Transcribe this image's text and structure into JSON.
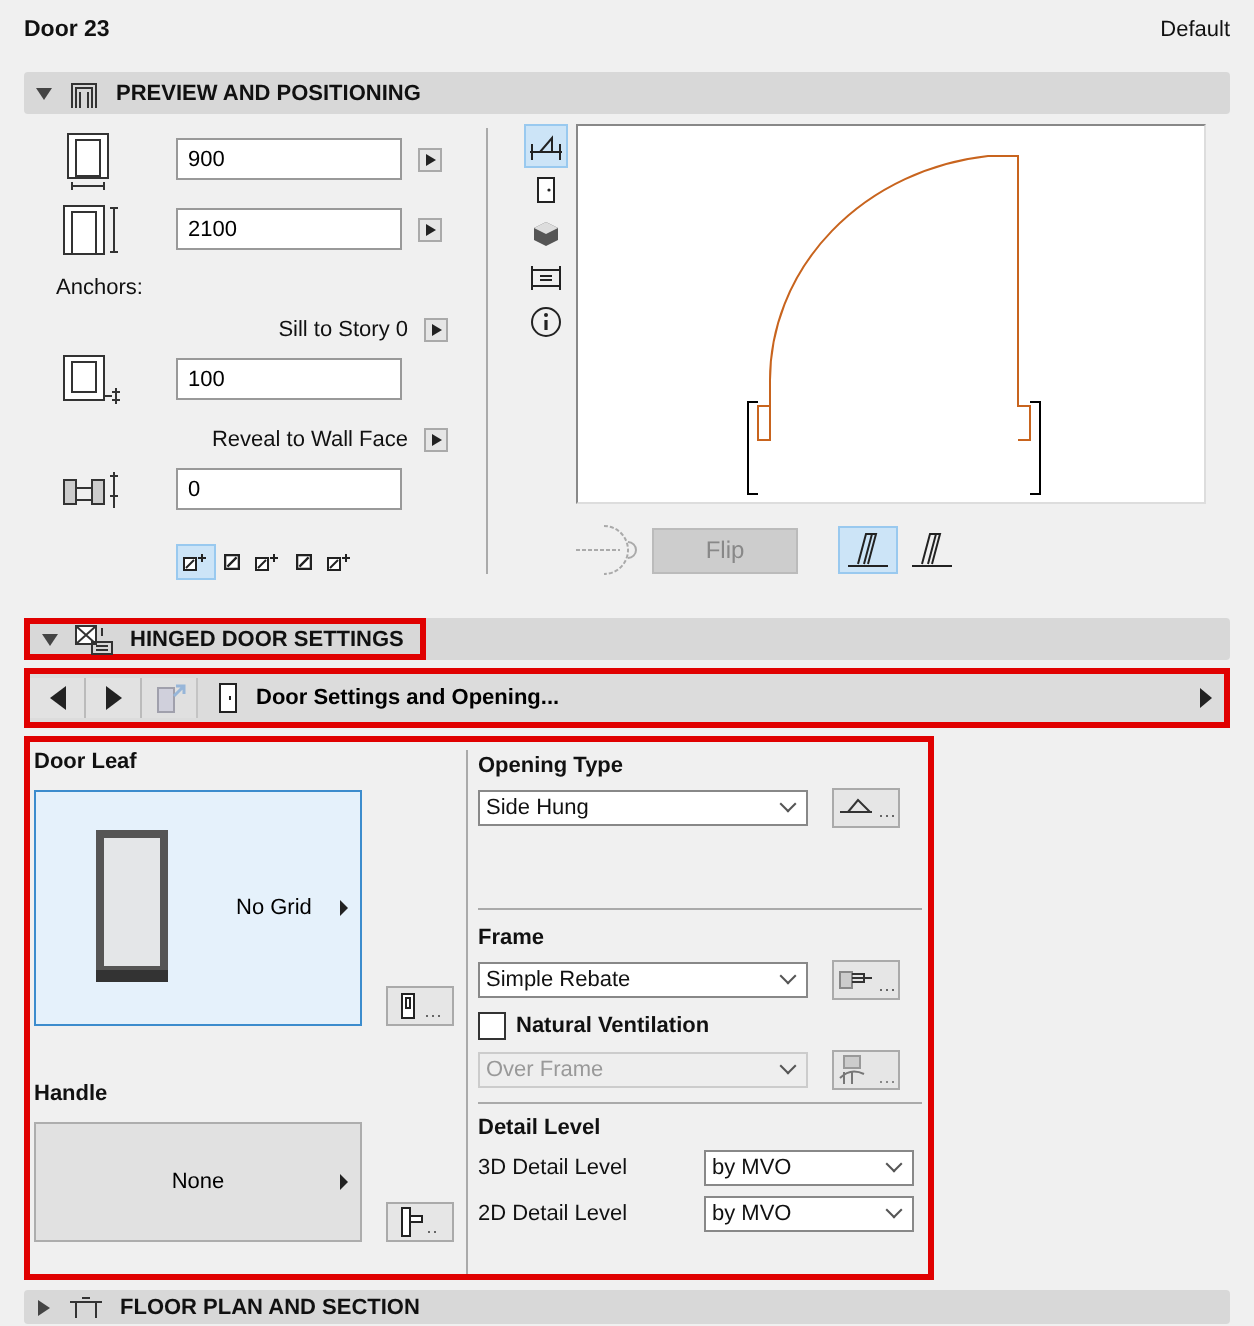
{
  "document": {
    "title": "Door 23",
    "preset": "Default"
  },
  "preview_section": {
    "title": "PREVIEW AND POSITIONING",
    "expanded": true
  },
  "width_field": {
    "value": "900"
  },
  "height_field": {
    "value": "2100"
  },
  "anchors_label": "Anchors:",
  "sill": {
    "label": "Sill to Story 0",
    "value": "100"
  },
  "reveal": {
    "label": "Reveal to Wall Face",
    "value": "0"
  },
  "anchor_buttons": [
    {
      "selected": true
    },
    {
      "selected": false
    },
    {
      "selected": false
    },
    {
      "selected": false
    },
    {
      "selected": false
    }
  ],
  "view_tabs": [
    {
      "kind": "plan",
      "selected": true
    },
    {
      "kind": "elevation",
      "selected": false
    },
    {
      "kind": "model",
      "selected": false
    },
    {
      "kind": "section",
      "selected": false
    },
    {
      "kind": "info",
      "selected": false
    }
  ],
  "flip_button": {
    "label": "Flip",
    "disabled": true
  },
  "side_buttons": [
    {
      "selected": true
    },
    {
      "selected": false
    }
  ],
  "hinged_section": {
    "title": "HINGED DOOR SETTINGS",
    "expanded": true,
    "highlighted": true
  },
  "page_nav": {
    "title": "Door Settings and Opening...",
    "highlighted": true
  },
  "settings_panel": {
    "highlighted": true
  },
  "door_leaf": {
    "title": "Door Leaf",
    "option": "No Grid"
  },
  "handle": {
    "title": "Handle",
    "option": "None"
  },
  "opening_type": {
    "title": "Opening Type",
    "value": "Side Hung"
  },
  "frame": {
    "title": "Frame",
    "value": "Simple Rebate"
  },
  "natural_ventilation": {
    "label": "Natural Ventilation",
    "checked": false,
    "value": "Over Frame",
    "disabled": true
  },
  "detail_level": {
    "title": "Detail Level",
    "rows": [
      {
        "label": "3D Detail Level",
        "value": "by MVO"
      },
      {
        "label": "2D Detail Level",
        "value": "by MVO"
      }
    ]
  },
  "floor_section": {
    "title": "FLOOR PLAN AND SECTION",
    "expanded": false
  }
}
